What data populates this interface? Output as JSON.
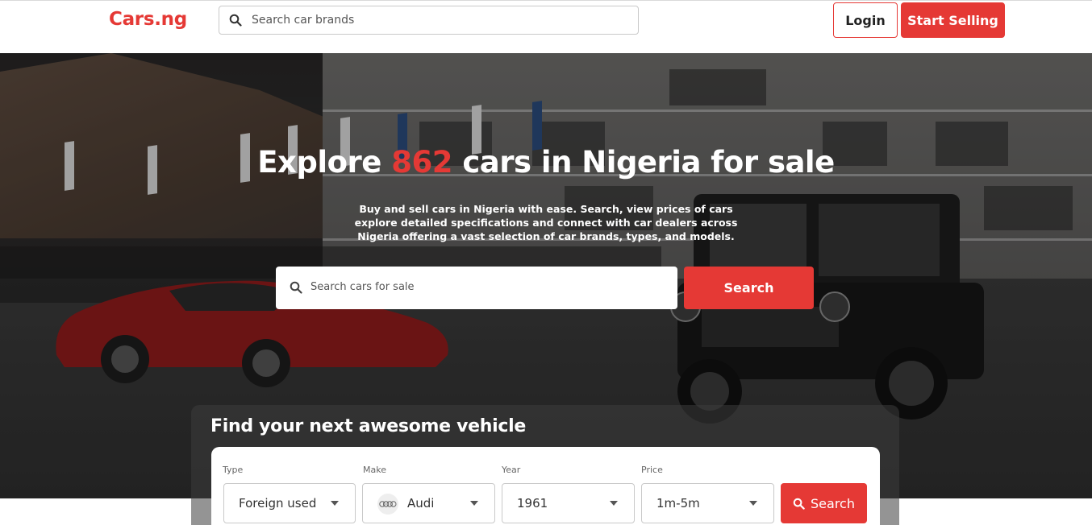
{
  "header": {
    "logo": "Cars.ng",
    "search_placeholder": "Search car brands",
    "login_label": "Login",
    "sell_label": "Start Selling"
  },
  "hero": {
    "title_prefix": "Explore ",
    "title_count": "862",
    "title_suffix": " cars in Nigeria for sale",
    "subtitle": "Buy and sell cars in Nigeria with ease. Search, view prices of cars explore detailed specifications and connect with car dealers across Nigeria offering a vast selection of car brands, types, and models.",
    "search_placeholder": "Search cars for sale",
    "search_label": "Search"
  },
  "finder": {
    "title": "Find your next awesome vehicle",
    "type_label": "Type",
    "type_value": "Foreign used",
    "make_label": "Make",
    "make_value": "Audi",
    "year_label": "Year",
    "year_value": "1961",
    "price_label": "Price",
    "price_value": "1m-5m",
    "search_label": "Search"
  },
  "colors": {
    "accent": "#e53935"
  }
}
